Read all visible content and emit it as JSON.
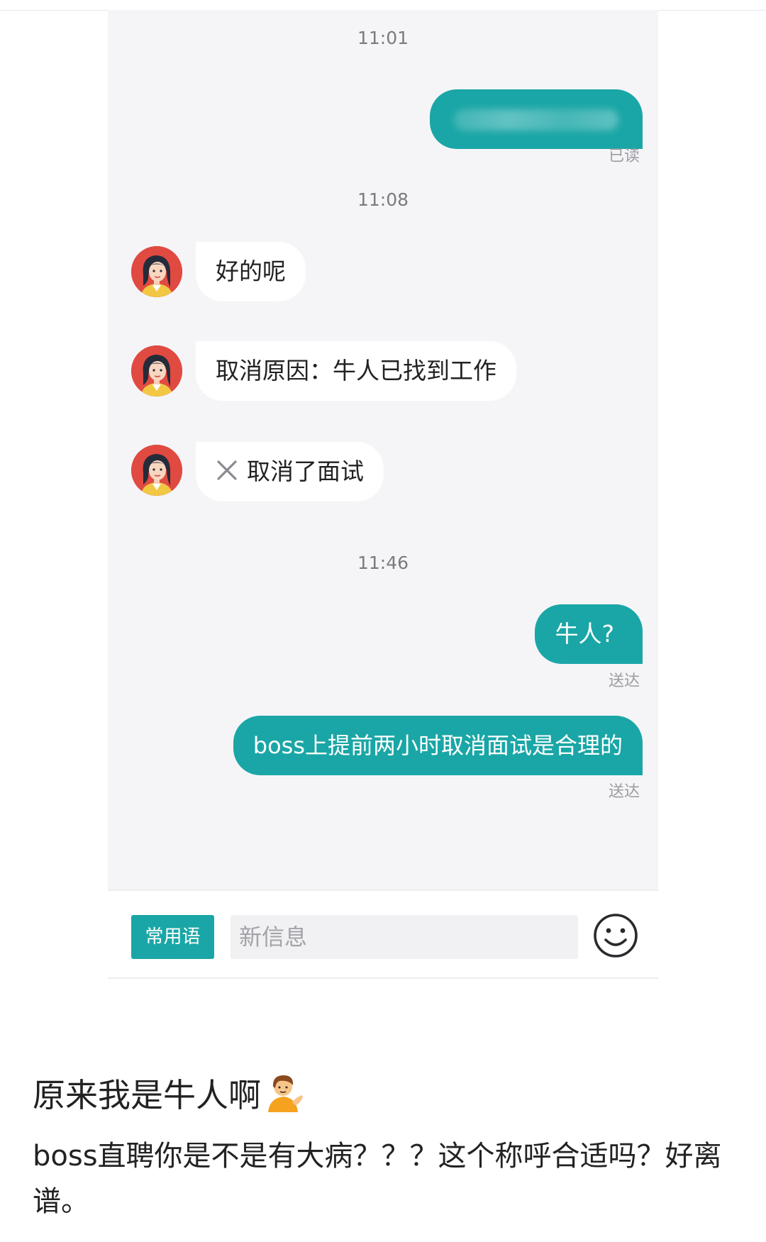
{
  "chat": {
    "time_1": "11:01",
    "read_receipt": "已读",
    "time_2": "11:08",
    "incoming_1": "好的呢",
    "incoming_2": "取消原因：牛人已找到工作",
    "incoming_3": "取消了面试",
    "time_3": "11:46",
    "outgoing_2": "牛人?",
    "delivered_1": "送达",
    "outgoing_3": "boss上提前两小时取消面试是合理的",
    "delivered_2": "送达"
  },
  "input_bar": {
    "phrases_label": "常用语",
    "placeholder": "新信息"
  },
  "post": {
    "title": "原来我是牛人啊",
    "body": "boss直聘你是不是有大病？？？这个称呼合适吗？好离谱。"
  },
  "colors": {
    "accent": "#1aa6a6",
    "chat_background": "#f5f5f8",
    "incoming_bubble": "#ffffff"
  },
  "icons": {
    "avatar": "woman-avatar-icon",
    "cancel": "x-icon",
    "emoji": "smiley-icon",
    "caption_emoji": "person-tipping-hand-icon"
  }
}
